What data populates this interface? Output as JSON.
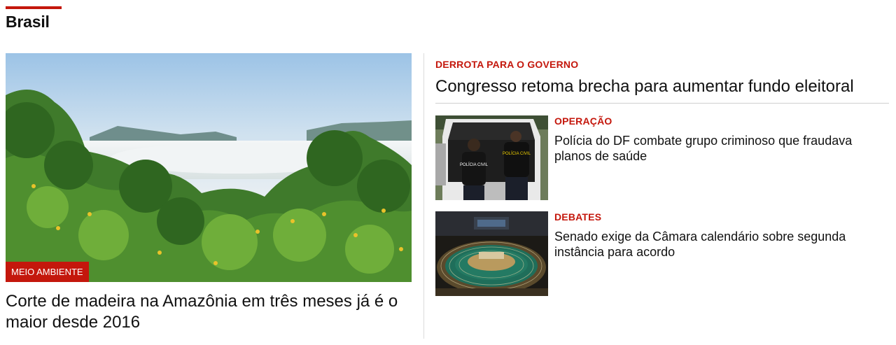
{
  "section": {
    "title": "Brasil"
  },
  "main_story": {
    "badge": "MEIO AMBIENTE",
    "headline": "Corte de madeira na Amazônia em três meses já é o maior desde 2016"
  },
  "top_story": {
    "kicker": "DERROTA PARA O GOVERNO",
    "headline": "Congresso retoma brecha para aumentar fundo eleitoral"
  },
  "stories": [
    {
      "kicker": "OPERAÇÃO",
      "headline": "Polícia do DF combate grupo criminoso que fraudava planos de saúde",
      "vest_front": "POLÍCIA CIVIL",
      "vest_back": "POLÍCIA CIVIL"
    },
    {
      "kicker": "DEBATES",
      "headline": "Senado exige da Câmara calendário sobre segunda instância para acordo"
    }
  ],
  "colors": {
    "accent": "#c4170c",
    "text": "#111111",
    "divider": "#dcdcdc"
  }
}
